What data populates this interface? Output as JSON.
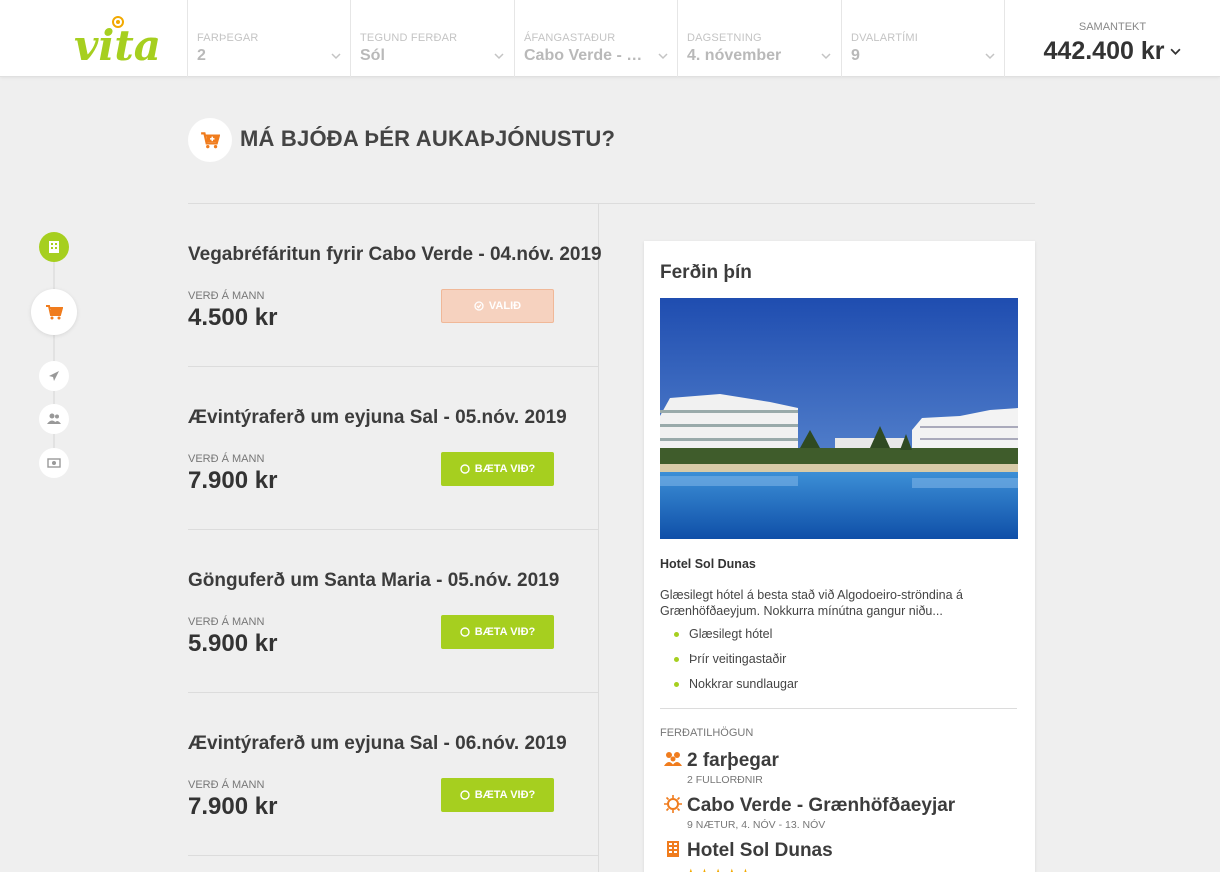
{
  "brand": {
    "logo_text": "vita",
    "accent": "#a6cf1f",
    "orange": "#f07c1d"
  },
  "header": {
    "filters": [
      {
        "label": "FARÞEGAR",
        "value": "2"
      },
      {
        "label": "TEGUND FERÐAR",
        "value": "Sól"
      },
      {
        "label": "ÁFANGASTAÐUR",
        "value": "Cabo Verde - Grænhöfðaeyjar"
      },
      {
        "label": "DAGSETNING",
        "value": "4. nóvember"
      },
      {
        "label": "DVALARTÍMI",
        "value": "9"
      }
    ],
    "summary": {
      "label": "SAMANTEKT",
      "total": "442.400 kr"
    }
  },
  "section": {
    "title": "MÁ BJÓÐA ÞÉR AUKAÞJÓNUSTU?",
    "icon": "cart-icon"
  },
  "steps": [
    {
      "icon": "hotel-icon",
      "state": "done"
    },
    {
      "icon": "cart-icon",
      "state": "active"
    },
    {
      "icon": "plane-icon",
      "state": "pending"
    },
    {
      "icon": "people-icon",
      "state": "pending"
    },
    {
      "icon": "payment-icon",
      "state": "pending"
    }
  ],
  "services": [
    {
      "name": "Vegabréfáritun fyrir Cabo Verde - 04.nóv. 2019",
      "price_label": "VERÐ Á MANN",
      "price": "4.500 kr",
      "button": "VALIÐ",
      "selected": true
    },
    {
      "name": "Ævintýraferð um eyjuna Sal - 05.nóv. 2019",
      "price_label": "VERÐ Á MANN",
      "price": "7.900 kr",
      "button": "BÆTA VIÐ?",
      "selected": false
    },
    {
      "name": "Gönguferð um Santa Maria - 05.nóv. 2019",
      "price_label": "VERÐ Á MANN",
      "price": "5.900 kr",
      "button": "BÆTA VIÐ?",
      "selected": false
    },
    {
      "name": "Ævintýraferð um eyjuna Sal - 06.nóv. 2019",
      "price_label": "VERÐ Á MANN",
      "price": "7.900 kr",
      "button": "BÆTA VIÐ?",
      "selected": false
    }
  ],
  "trip": {
    "title": "Ferðin þín",
    "hotel_name": "Hotel Sol Dunas",
    "description": "Glæsilegt hótel á besta stað við Algodoeiro-ströndina á Grænhöfðaeyjum. Nokkurra mínútna gangur niðu...",
    "features": [
      "Glæsilegt hótel",
      "Þrír veitingastaðir",
      "Nokkrar sundlaugar"
    ],
    "arrangement_label": "FERÐATILHÖGUN",
    "travelers": {
      "title": "2 farþegar",
      "sub": "2 FULLORÐNIR"
    },
    "destination": {
      "title": "Cabo Verde - Grænhöfðaeyjar",
      "sub": "9 NÆTUR, 4. NÓV - 13. NÓV"
    },
    "hotel": {
      "title": "Hotel Sol Dunas",
      "stars": "★★★★★"
    }
  }
}
